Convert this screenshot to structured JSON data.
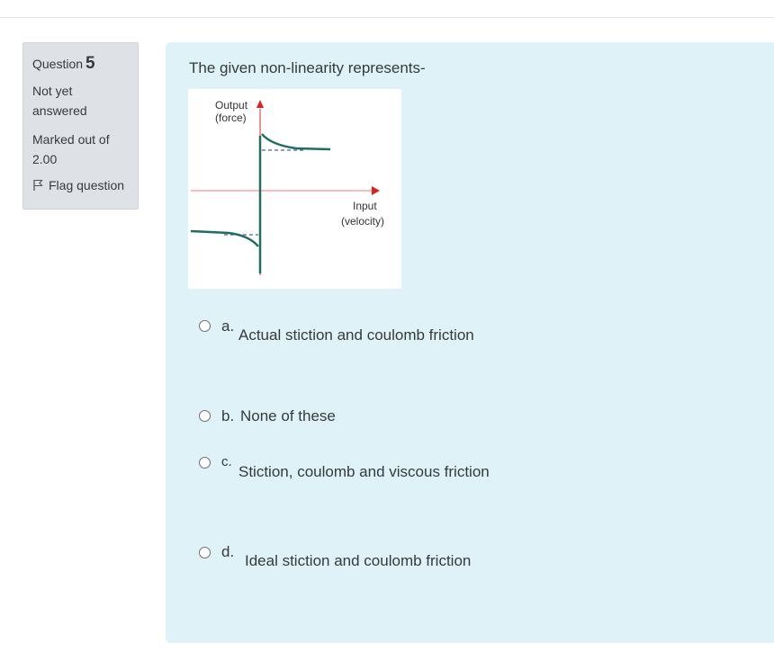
{
  "info": {
    "question_label": "Question",
    "question_number": "5",
    "state_line1": "Not yet",
    "state_line2": "answered",
    "grade_line1": "Marked out of",
    "grade_line2": "2.00",
    "flag_label": "Flag question"
  },
  "question": {
    "text": "The given non-linearity represents-",
    "figure": {
      "y_label_line1": "Output",
      "y_label_line2": "(force)",
      "x_label_line1": "Input",
      "x_label_line2": "(velocity)"
    }
  },
  "options": [
    {
      "letter": "a.",
      "text": "Actual stiction and coulomb friction"
    },
    {
      "letter": "b.",
      "text": "None of these"
    },
    {
      "letter": "c.",
      "text": "Stiction, coulomb and viscous friction"
    },
    {
      "letter": "d.",
      "text": "Ideal stiction and coulomb friction"
    }
  ],
  "colors": {
    "panel_bg": "#def2f8",
    "info_bg": "#dee2e6",
    "curve": "#1f6e5e",
    "axis_arrow": "#e02020",
    "dashed": "#4a5fb0"
  },
  "icons": {
    "flag": "flag-outline-icon",
    "radio": "radio-unchecked-icon"
  }
}
